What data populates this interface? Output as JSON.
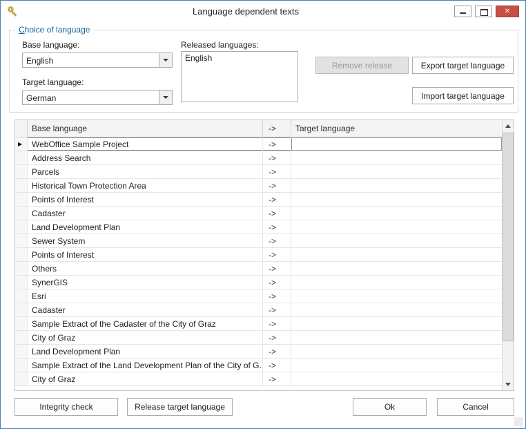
{
  "window": {
    "title": "Language dependent texts"
  },
  "choice": {
    "group_label": "Choice of language",
    "base_language_label": "Base language:",
    "base_language_value": "English",
    "target_language_label": "Target language:",
    "target_language_value": "German",
    "released_languages_label": "Released languages:",
    "released_languages": [
      "English"
    ],
    "remove_release_label": "Remove release",
    "export_target_label": "Export target language",
    "import_target_label": "Import target language"
  },
  "grid": {
    "columns": {
      "base": "Base language",
      "arrow": "->",
      "target": "Target language"
    },
    "arrow": "->",
    "selected_index": 0,
    "rows": [
      {
        "base": "WebOffice Sample Project",
        "target": ""
      },
      {
        "base": "Address Search",
        "target": ""
      },
      {
        "base": "Parcels",
        "target": ""
      },
      {
        "base": "Historical Town Protection Area",
        "target": ""
      },
      {
        "base": "Points of Interest",
        "target": ""
      },
      {
        "base": "Cadaster",
        "target": ""
      },
      {
        "base": "Land Development Plan",
        "target": ""
      },
      {
        "base": "Sewer System",
        "target": ""
      },
      {
        "base": "Points of Interest",
        "target": ""
      },
      {
        "base": "Others",
        "target": ""
      },
      {
        "base": "SynerGIS",
        "target": ""
      },
      {
        "base": "Esri",
        "target": ""
      },
      {
        "base": "Cadaster",
        "target": ""
      },
      {
        "base": "Sample Extract of the Cadaster of the City of Graz",
        "target": ""
      },
      {
        "base": "City of Graz",
        "target": ""
      },
      {
        "base": "Land Development Plan",
        "target": ""
      },
      {
        "base": "Sample Extract of the Land Development Plan of the City of G...",
        "target": ""
      },
      {
        "base": "City of Graz",
        "target": ""
      }
    ]
  },
  "footer": {
    "integrity_check": "Integrity check",
    "release_target": "Release target language",
    "ok": "Ok",
    "cancel": "Cancel"
  }
}
